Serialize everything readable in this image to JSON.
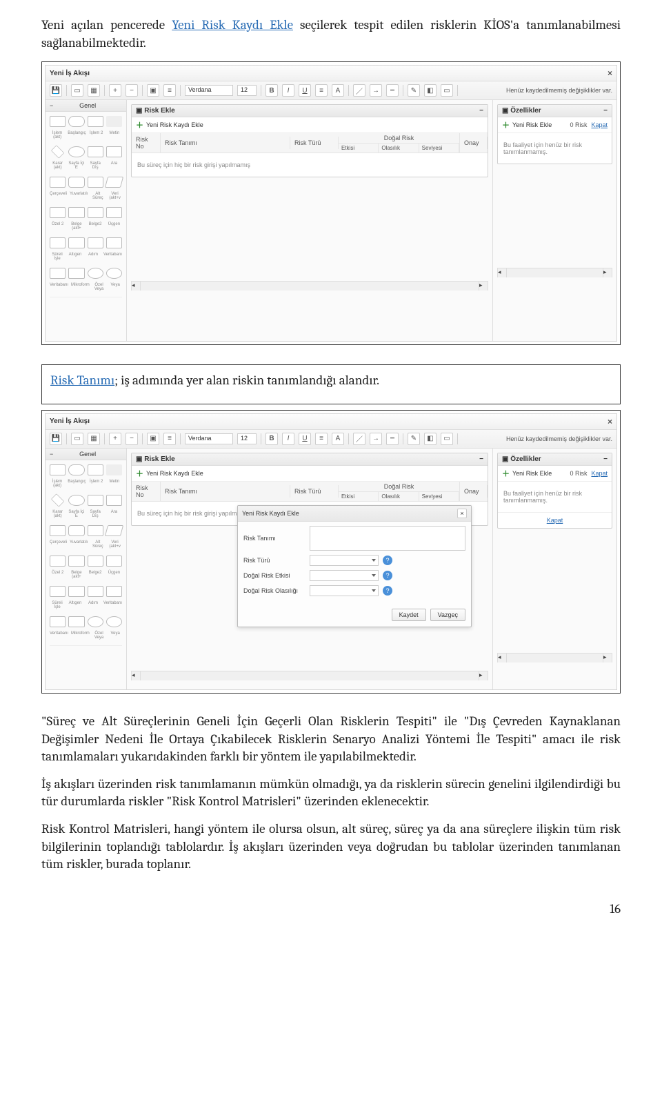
{
  "intro": {
    "t1a": "Yeni açılan pencerede ",
    "link1": "Yeni Risk Kaydı Ekle",
    "t1b": " seçilerek tespit edilen risklerin KİOS'a tanımlanabilmesi sağlanabilmektedir."
  },
  "p2": {
    "link": "Risk Tanımı",
    "rest": "; iş adımında yer alan riskin tanımlandığı alandır."
  },
  "app": {
    "title": "Yeni İş Akışı",
    "toolbar": {
      "font": "Verdana",
      "fontsize": "12",
      "status": "Henüz kaydedilmemiş değişiklikler var."
    },
    "palette": {
      "head": "Genel",
      "rows": [
        [
          "İşlem (akt)",
          "Başlangıç",
          "İşlem 2",
          "Metin"
        ],
        [
          "Karar (akt)",
          "Sayfa İçi E",
          "Sayfa Dış",
          "Ara"
        ],
        [
          "Çerçeveli",
          "Yuvarlatılı",
          "Alt Süreç",
          "Veri (akt+v"
        ],
        [
          "Özel 2",
          "Belge (akt+",
          "Belge2",
          "Üçgen"
        ],
        [
          "Süreli İşle",
          "Altıgen",
          "Adım",
          "Veritabanı"
        ],
        [
          "Veritabanı",
          "Mikroform",
          "Özel Veya",
          "Veya"
        ]
      ]
    },
    "risk_panel": {
      "title": "Risk Ekle",
      "add": "Yeni Risk Kaydı Ekle",
      "cols": {
        "no": "Risk No",
        "tanim": "Risk Tanımı",
        "tur": "Risk Türü",
        "grp": "Doğal Risk",
        "etki": "Etkisi",
        "olas": "Olasılık",
        "sev": "Seviyesi",
        "onay": "Onay"
      },
      "empty": "Bu süreç için hiç bir risk girişi yapılmamış"
    },
    "props": {
      "title": "Özellikler",
      "add": "Yeni Risk Ekle",
      "count": "0  Risk",
      "kapat": "Kapat",
      "empty": "Bu faaliyet için henüz bir risk tanımlanmamış."
    },
    "dialog": {
      "title": "Yeni Risk Kaydı Ekle",
      "f1": "Risk Tanımı",
      "f2": "Risk Türü",
      "f3": "Doğal Risk Etkisi",
      "f4": "Doğal Risk Olasılığı",
      "save": "Kaydet",
      "cancel": "Vazgeç"
    }
  },
  "para3": "\"Süreç ve Alt Süreçlerinin Geneli İçin Geçerli Olan Risklerin Tespiti\" ile \"Dış Çevreden Kaynaklanan Değişimler Nedeni İle Ortaya Çıkabilecek Risklerin Senaryo Analizi Yöntemi İle Tespiti\" amacı ile risk tanımlamaları yukarıdakinden farklı bir yöntem ile yapılabilmektedir.",
  "para4": "İş akışları üzerinden risk tanımlamanın mümkün olmadığı, ya da risklerin sürecin genelini ilgilendirdiği bu tür durumlarda riskler \"Risk Kontrol Matrisleri\" üzerinden eklenecektir.",
  "para5": "Risk Kontrol Matrisleri, hangi yöntem ile olursa olsun, alt süreç, süreç ya da ana süreçlere ilişkin tüm risk bilgilerinin toplandığı tablolardır. İş akışları üzerinden veya doğrudan bu tablolar üzerinden tanımlanan tüm riskler, burada toplanır.",
  "page": "16"
}
